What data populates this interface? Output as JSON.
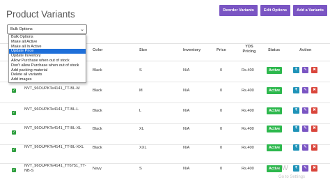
{
  "page": {
    "title": "Product Variants"
  },
  "actions": {
    "reorder": "Reorder Variants",
    "edit_options": "Edit Options",
    "add": "Add a Variants"
  },
  "bulk": {
    "selected": "Bulk Options",
    "options": [
      "Bulk Options",
      "Make all Active",
      "Make all In Active",
      "Update Price",
      "Update Inventory",
      "Allow Purchase when out of stock",
      "Don't allow Purchase when out of stock",
      "Add packing material",
      "Delete all variants",
      "Add images"
    ],
    "highlighted_index": 3
  },
  "table": {
    "headers": {
      "color": "Color",
      "size": "Size",
      "inventory": "Inventory",
      "price": "Price",
      "yds_line1": "YDS",
      "yds_line2": "Pricing",
      "status": "Status",
      "action": "Action"
    },
    "rows": [
      {
        "sku": "",
        "color": "Black",
        "size": "S",
        "inventory": "N/A",
        "price": "0",
        "yds": "Rs.400",
        "status": "Active"
      },
      {
        "sku": "NVT_96OUPKTe4141_TT-BL-M",
        "color": "Black",
        "size": "M",
        "inventory": "N/A",
        "price": "0",
        "yds": "Rs.400",
        "status": "Active"
      },
      {
        "sku": "NVT_96OUPKTe4141_TT-BL-L",
        "color": "Black",
        "size": "L",
        "inventory": "N/A",
        "price": "0",
        "yds": "Rs.400",
        "status": "Active"
      },
      {
        "sku": "NVT_96OUPKTe4141_TT-BL-XL",
        "color": "Black",
        "size": "XL",
        "inventory": "N/A",
        "price": "0",
        "yds": "Rs.400",
        "status": "Active"
      },
      {
        "sku": "NVT_96OUPKTe4141_TT-BL-XXL",
        "color": "Black",
        "size": "XXL",
        "inventory": "N/A",
        "price": "0",
        "yds": "Rs.400",
        "status": "Active"
      },
      {
        "sku": "NVT_96OUPKTe4141_TT6751_TT-",
        "sku2": "NB-S",
        "color": "Navy",
        "size": "S",
        "inventory": "N/A",
        "price": "0",
        "yds": "Rs.400",
        "status": "Active"
      }
    ]
  },
  "overlay": {
    "watermark_main": "e W",
    "watermark_sub": "Go to Settings"
  },
  "colors": {
    "accent_purple": "#7a55c3",
    "status_green": "#2db84d",
    "price_teal": "#1f93b8",
    "delete_red": "#d9453b",
    "select_blue": "#1e6fd9",
    "check_green": "#2e9e3e"
  },
  "icons": {
    "price": "rupee-icon",
    "edit": "pencil-icon",
    "delete": "trash-icon",
    "check": "checkmark-icon"
  }
}
